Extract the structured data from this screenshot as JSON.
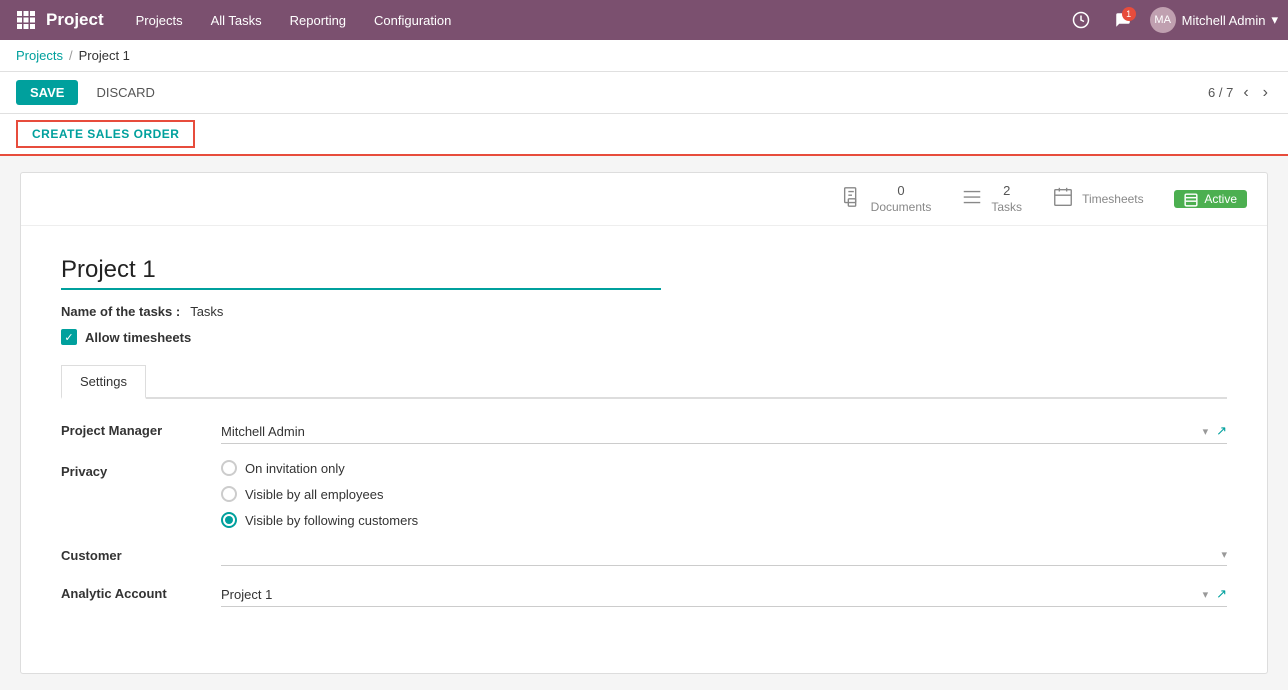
{
  "topbar": {
    "app_title": "Project",
    "nav_items": [
      "Projects",
      "All Tasks",
      "Reporting",
      "Configuration"
    ],
    "user_name": "Mitchell Admin",
    "notif_count": "1"
  },
  "breadcrumb": {
    "parent": "Projects",
    "separator": "/",
    "current": "Project 1"
  },
  "action_bar": {
    "save_label": "SAVE",
    "discard_label": "DISCARD",
    "pagination": "6 / 7"
  },
  "sales_order_bar": {
    "button_label": "CREATE SALES ORDER"
  },
  "card": {
    "stats": [
      {
        "icon": "📋",
        "count": "0",
        "label": "Documents"
      },
      {
        "icon": "≡",
        "count": "2",
        "label": "Tasks"
      },
      {
        "icon": "📅",
        "label": "Timesheets"
      }
    ],
    "active_label": "Active",
    "project_name": "Project 1",
    "name_of_tasks_label": "Name of the tasks :",
    "name_of_tasks_value": "Tasks",
    "allow_timesheets_label": "Allow timesheets",
    "tab_settings": "Settings",
    "settings": {
      "project_manager_label": "Project Manager",
      "project_manager_value": "Mitchell Admin",
      "privacy_label": "Privacy",
      "privacy_options": [
        {
          "label": "On invitation only",
          "selected": false
        },
        {
          "label": "Visible by all employees",
          "selected": false
        },
        {
          "label": "Visible by following customers",
          "selected": true
        }
      ],
      "customer_label": "Customer",
      "analytic_account_label": "Analytic Account",
      "analytic_account_value": "Project 1"
    }
  }
}
